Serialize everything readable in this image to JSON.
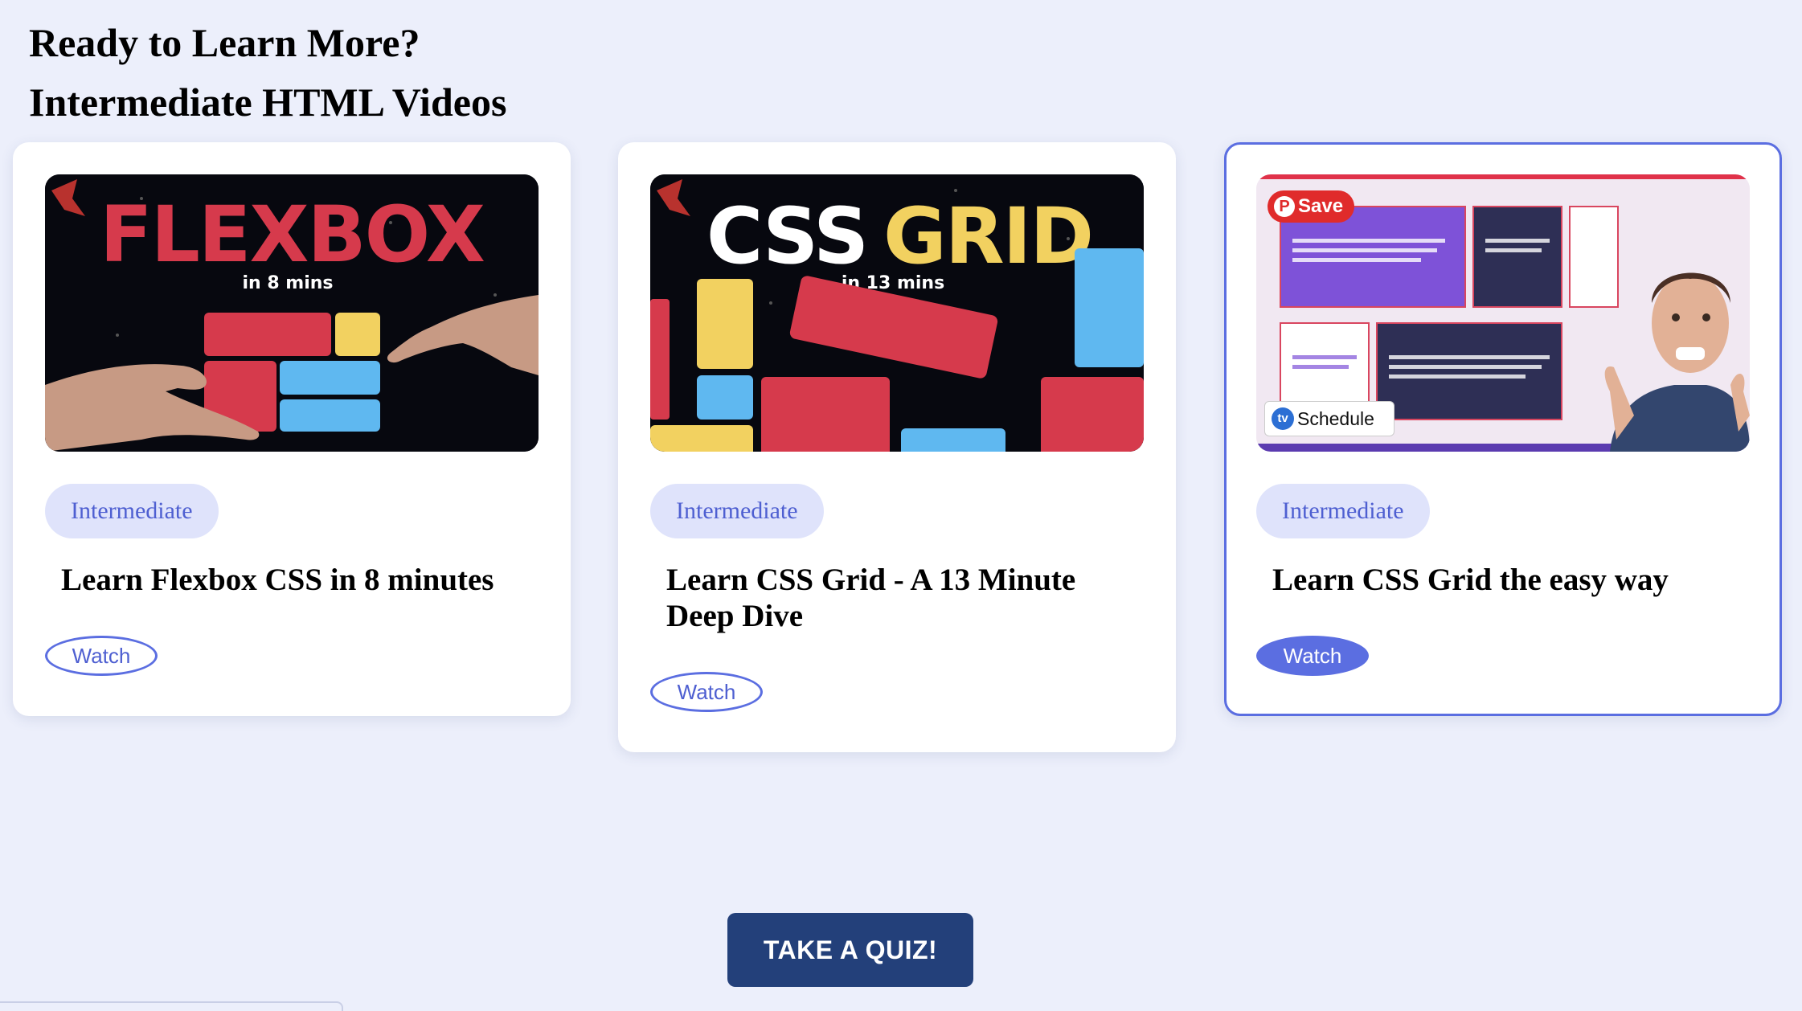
{
  "page": {
    "heading": "Ready to Learn More?",
    "subheading": "Intermediate HTML Videos"
  },
  "cards": [
    {
      "thumbnail": {
        "headline": "FLEXBOX",
        "caption": "in 8 mins"
      },
      "level": "Intermediate",
      "title": "Learn Flexbox CSS in 8 minutes",
      "watch_label": "Watch"
    },
    {
      "thumbnail": {
        "headline_1": "CSS",
        "headline_2": "GRID",
        "caption": "in 13 mins"
      },
      "level": "Intermediate",
      "title": "Learn CSS Grid - A 13 Minute Deep Dive",
      "watch_label": "Watch"
    },
    {
      "thumbnail": {
        "save_label": "Save",
        "schedule_label": "Schedule",
        "schedule_logo": "tv"
      },
      "level": "Intermediate",
      "title": "Learn CSS Grid the easy way",
      "watch_label": "Watch",
      "selected": true
    }
  ],
  "quiz_button": "TAKE A QUIZ!",
  "colors": {
    "background": "#eceffb",
    "accent": "#5b6ee1",
    "pill_bg": "#dfe3fb",
    "quiz_bg": "#23407a",
    "red_block": "#d63a4c",
    "yellow_block": "#f2d160",
    "blue_block": "#5fb8f0"
  }
}
